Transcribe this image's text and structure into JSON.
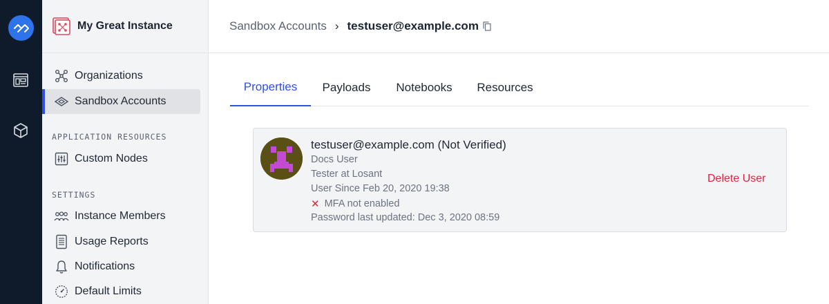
{
  "rail": {
    "logo_icon": "losant-logo-icon",
    "items": [
      {
        "icon": "dashboard-icon"
      },
      {
        "icon": "cube-icon"
      }
    ],
    "brand_color": "#2f73ea"
  },
  "sidebar": {
    "instance_name": "My Great Instance",
    "items_top": [
      {
        "label": "Organizations",
        "icon": "organizations-icon"
      },
      {
        "label": "Sandbox Accounts",
        "icon": "sandbox-icon",
        "active": true
      }
    ],
    "section_app": "APPLICATION RESOURCES",
    "items_app": [
      {
        "label": "Custom Nodes",
        "icon": "custom-nodes-icon"
      }
    ],
    "section_settings": "SETTINGS",
    "items_settings": [
      {
        "label": "Instance Members",
        "icon": "members-icon"
      },
      {
        "label": "Usage Reports",
        "icon": "usage-reports-icon"
      },
      {
        "label": "Notifications",
        "icon": "bell-icon"
      },
      {
        "label": "Default Limits",
        "icon": "gauge-icon"
      }
    ]
  },
  "header": {
    "breadcrumb_parent": "Sandbox Accounts",
    "breadcrumb_separator": "›",
    "breadcrumb_current": "testuser@example.com"
  },
  "tabs": [
    {
      "label": "Properties",
      "active": true
    },
    {
      "label": "Payloads"
    },
    {
      "label": "Notebooks"
    },
    {
      "label": "Resources"
    }
  ],
  "user": {
    "title": "testuser@example.com (Not Verified)",
    "name": "Docs User",
    "role": "Tester at Losant",
    "since": "User Since Feb 20, 2020 19:38",
    "mfa_mark": "✕",
    "mfa": "MFA not enabled",
    "password_updated": "Password last updated: Dec 3, 2020 08:59",
    "delete_label": "Delete User"
  },
  "colors": {
    "accent": "#2f50e8",
    "danger": "#e0253a",
    "rail_bg": "#0f1b2a",
    "sidebar_bg": "#f3f4f6"
  }
}
